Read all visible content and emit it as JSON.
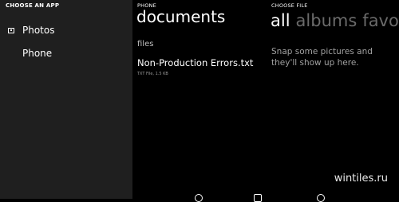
{
  "left_panel": {
    "header": "CHOOSE AN APP",
    "apps": [
      {
        "label": "Photos",
        "icon": "photos-icon"
      },
      {
        "label": "Phone",
        "icon": ""
      }
    ]
  },
  "phone_panel": {
    "caption": "PHONE",
    "title": "documents",
    "section": "files",
    "files": [
      {
        "name": "Non-Production Errors.txt",
        "meta": "TXT File, 1.5 KB"
      }
    ]
  },
  "choose_panel": {
    "caption": "CHOOSE FILE",
    "pivots": [
      {
        "label": "all",
        "active": true
      },
      {
        "label": "albums",
        "active": false
      },
      {
        "label": "favo",
        "active": false
      }
    ],
    "empty_message": "Snap some pictures and they'll show up here."
  },
  "watermark": "wintiles.ru"
}
